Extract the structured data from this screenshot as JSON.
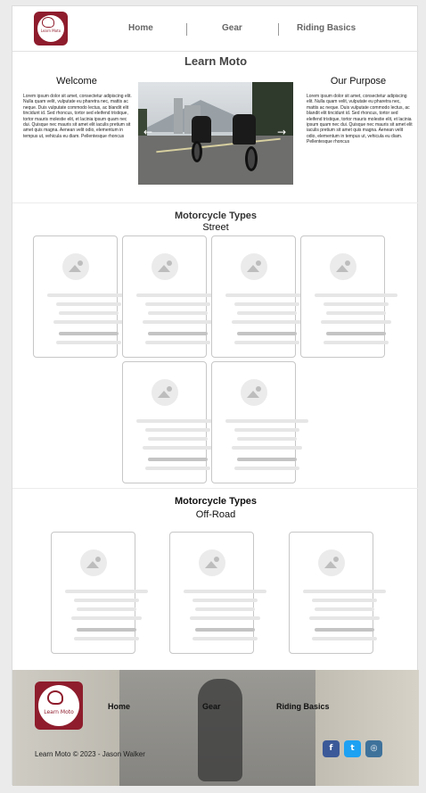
{
  "header": {
    "logo_text": "Learn Moto",
    "nav": [
      {
        "label": "Home"
      },
      {
        "label": "Gear"
      },
      {
        "label": "Riding Basics"
      }
    ]
  },
  "intro": {
    "title": "Learn Moto",
    "welcome": {
      "heading": "Welcome",
      "body": "Lorem ipsum dolor sit amet, consectetur adipiscing elit. Nulla quam velit, vulputate eu pharetra nec, mattis ac neque. Duis vulputate commodo lectus, ac blandit elit tincidunt id. Sed rhoncus, tortor sed eleifend tristique, tortor mauris molestie elit, et lacinia ipsum quam nec dui. Quisque nec mauris sit amet elit iaculis pretium sit amet quis magna. Aenean velit odio, elementum in tempus ut, vehicula eu diam. Pellentesque rhoncus"
    },
    "purpose": {
      "heading": "Our Purpose",
      "body": "Lorem ipsum dolor sit amet, consectetur adipiscing elit. Nulla quam velit, vulputate eu pharetra nec, mattis ac neque. Duis vulputate commodo lectus, ac blandit elit tincidunt id. Sed rhoncus, tortor sed eleifend tristique, tortor mauris molestie elit, et lacinia ipsum quam nec dui. Quisque nec mauris sit amet elit iaculis pretium sit amet quis magna. Aenean velit odio, elementum in tempus ut, vehicula eu diam. Pellentesque rhoncus"
    },
    "carousel": {
      "prev": "←",
      "next": "→"
    }
  },
  "street": {
    "title": "Motorcycle Types",
    "subtitle": "Street",
    "card_count": 6
  },
  "offroad": {
    "title": "Motorcycle Types",
    "subtitle": "Off-Road",
    "card_count": 3
  },
  "footer": {
    "logo_text": "Learn Moto",
    "nav": [
      {
        "label": "Home"
      },
      {
        "label": "Gear"
      },
      {
        "label": "Riding Basics"
      }
    ],
    "copyright": "Learn Moto © 2023 - Jason Walker",
    "social": [
      {
        "icon": "facebook-icon",
        "glyph": "f",
        "color": "#3b5998"
      },
      {
        "icon": "twitter-icon",
        "glyph": "t",
        "color": "#1da1f2"
      },
      {
        "icon": "instagram-icon",
        "glyph": "◎",
        "color": "#3f729b"
      }
    ]
  }
}
